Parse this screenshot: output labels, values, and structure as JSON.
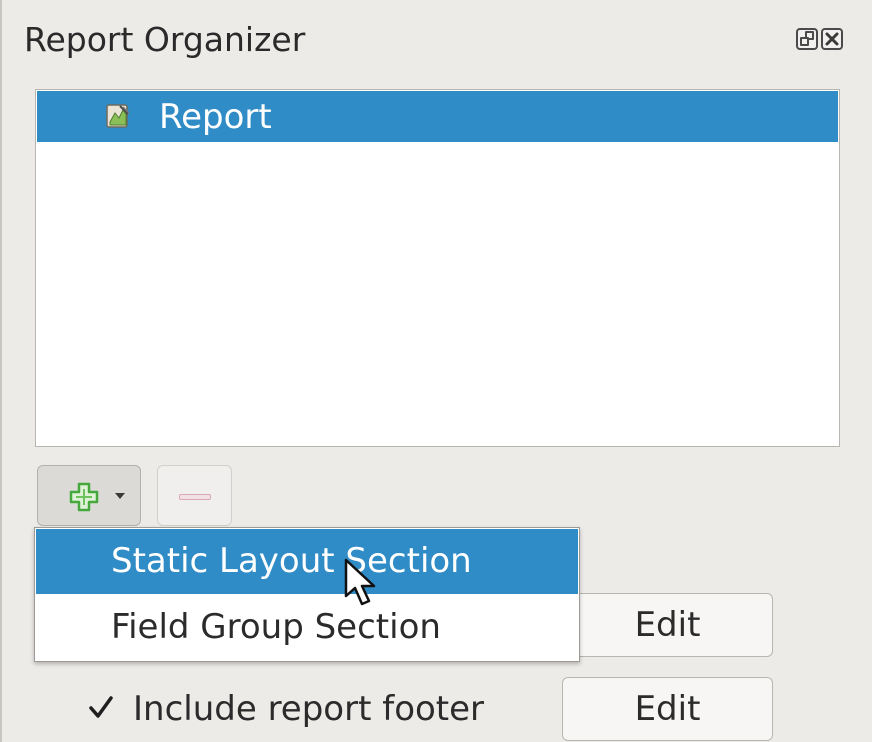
{
  "panel": {
    "title": "Report Organizer",
    "float_icon": "float-icon",
    "close_icon": "close-icon"
  },
  "tree": {
    "items": [
      {
        "label": "Report",
        "icon": "report-icon",
        "selected": true
      }
    ]
  },
  "toolbar": {
    "add_icon": "plus-icon",
    "dropdown_icon": "chevron-down-icon",
    "remove_icon": "minus-icon"
  },
  "menu": {
    "items": [
      {
        "label": "Static Layout Section",
        "highlighted": true
      },
      {
        "label": "Field Group Section",
        "highlighted": false
      }
    ]
  },
  "header_row": {
    "edit_label": "Edit"
  },
  "footer_row": {
    "checkbox_checked": true,
    "label": "Include report footer",
    "edit_label": "Edit"
  },
  "colors": {
    "selection": "#308cc6",
    "panel_background": "#edebe8",
    "add_icon_green": "#46a83c"
  }
}
